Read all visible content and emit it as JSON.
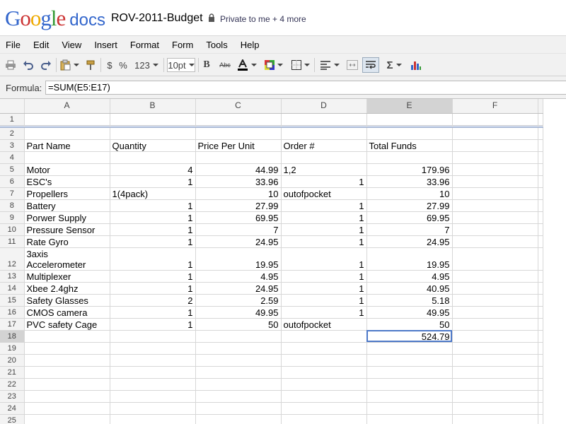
{
  "app": {
    "logo_google": "Google",
    "logo_docs": "docs"
  },
  "document": {
    "title": "ROV-2011-Budget",
    "sharing": "Private to me + 4 more"
  },
  "menu": [
    "File",
    "Edit",
    "View",
    "Insert",
    "Format",
    "Form",
    "Tools",
    "Help"
  ],
  "toolbar": {
    "currency": "$",
    "percent": "%",
    "number_format": "123",
    "font_size": "10pt",
    "bold": "B",
    "strikethrough": "Abc",
    "sum": "Σ"
  },
  "formula_bar": {
    "label": "Formula:",
    "value": "=SUM(E5:E17)"
  },
  "sheet": {
    "columns": [
      "A",
      "B",
      "C",
      "D",
      "E",
      "F"
    ],
    "selected_cell": "E18",
    "rows": [
      {
        "num": "1",
        "cells": [
          "",
          "",
          "",
          "",
          "",
          ""
        ]
      },
      {
        "num": "2",
        "cells": [
          "",
          "",
          "",
          "",
          "",
          ""
        ]
      },
      {
        "num": "3",
        "cells": [
          "Part Name",
          "Quantity",
          "Price Per Unit",
          "Order #",
          "Total Funds",
          ""
        ]
      },
      {
        "num": "4",
        "cells": [
          "",
          "",
          "",
          "",
          "",
          ""
        ]
      },
      {
        "num": "5",
        "cells": [
          "Motor",
          "4",
          "44.99",
          "1,2",
          "179.96",
          ""
        ]
      },
      {
        "num": "6",
        "cells": [
          "ESC's",
          "1",
          "33.96",
          "1",
          "33.96",
          ""
        ]
      },
      {
        "num": "7",
        "cells": [
          "Propellers",
          "1(4pack)",
          "10",
          "outofpocket",
          "10",
          ""
        ]
      },
      {
        "num": "8",
        "cells": [
          "Battery",
          "1",
          "27.99",
          "1",
          "27.99",
          ""
        ]
      },
      {
        "num": "9",
        "cells": [
          "Porwer Supply",
          "1",
          "69.95",
          "1",
          "69.95",
          ""
        ]
      },
      {
        "num": "10",
        "cells": [
          "Pressure Sensor",
          "1",
          "7",
          "1",
          "7",
          ""
        ]
      },
      {
        "num": "11",
        "cells": [
          "Rate Gyro",
          "1",
          "24.95",
          "1",
          "24.95",
          ""
        ]
      },
      {
        "num": "12",
        "cells": [
          "3axis Accelerometer",
          "1",
          "19.95",
          "1",
          "19.95",
          ""
        ]
      },
      {
        "num": "13",
        "cells": [
          "Multiplexer",
          "1",
          "4.95",
          "1",
          "4.95",
          ""
        ]
      },
      {
        "num": "14",
        "cells": [
          "Xbee 2.4ghz",
          "1",
          "24.95",
          "1",
          "40.95",
          ""
        ]
      },
      {
        "num": "15",
        "cells": [
          "Safety Glasses",
          "2",
          "2.59",
          "1",
          "5.18",
          ""
        ]
      },
      {
        "num": "16",
        "cells": [
          "CMOS camera",
          "1",
          "49.95",
          "1",
          "49.95",
          ""
        ]
      },
      {
        "num": "17",
        "cells": [
          "PVC safety Cage",
          "1",
          "50",
          "outofpocket",
          "50",
          ""
        ]
      },
      {
        "num": "18",
        "cells": [
          "",
          "",
          "",
          "",
          "524.79",
          ""
        ]
      },
      {
        "num": "19",
        "cells": [
          "",
          "",
          "",
          "",
          "",
          ""
        ]
      },
      {
        "num": "20",
        "cells": [
          "",
          "",
          "",
          "",
          "",
          ""
        ]
      },
      {
        "num": "21",
        "cells": [
          "",
          "",
          "",
          "",
          "",
          ""
        ]
      },
      {
        "num": "22",
        "cells": [
          "",
          "",
          "",
          "",
          "",
          ""
        ]
      },
      {
        "num": "23",
        "cells": [
          "",
          "",
          "",
          "",
          "",
          ""
        ]
      },
      {
        "num": "24",
        "cells": [
          "",
          "",
          "",
          "",
          "",
          ""
        ]
      },
      {
        "num": "25",
        "cells": [
          "",
          "",
          "",
          "",
          "",
          ""
        ]
      }
    ]
  }
}
